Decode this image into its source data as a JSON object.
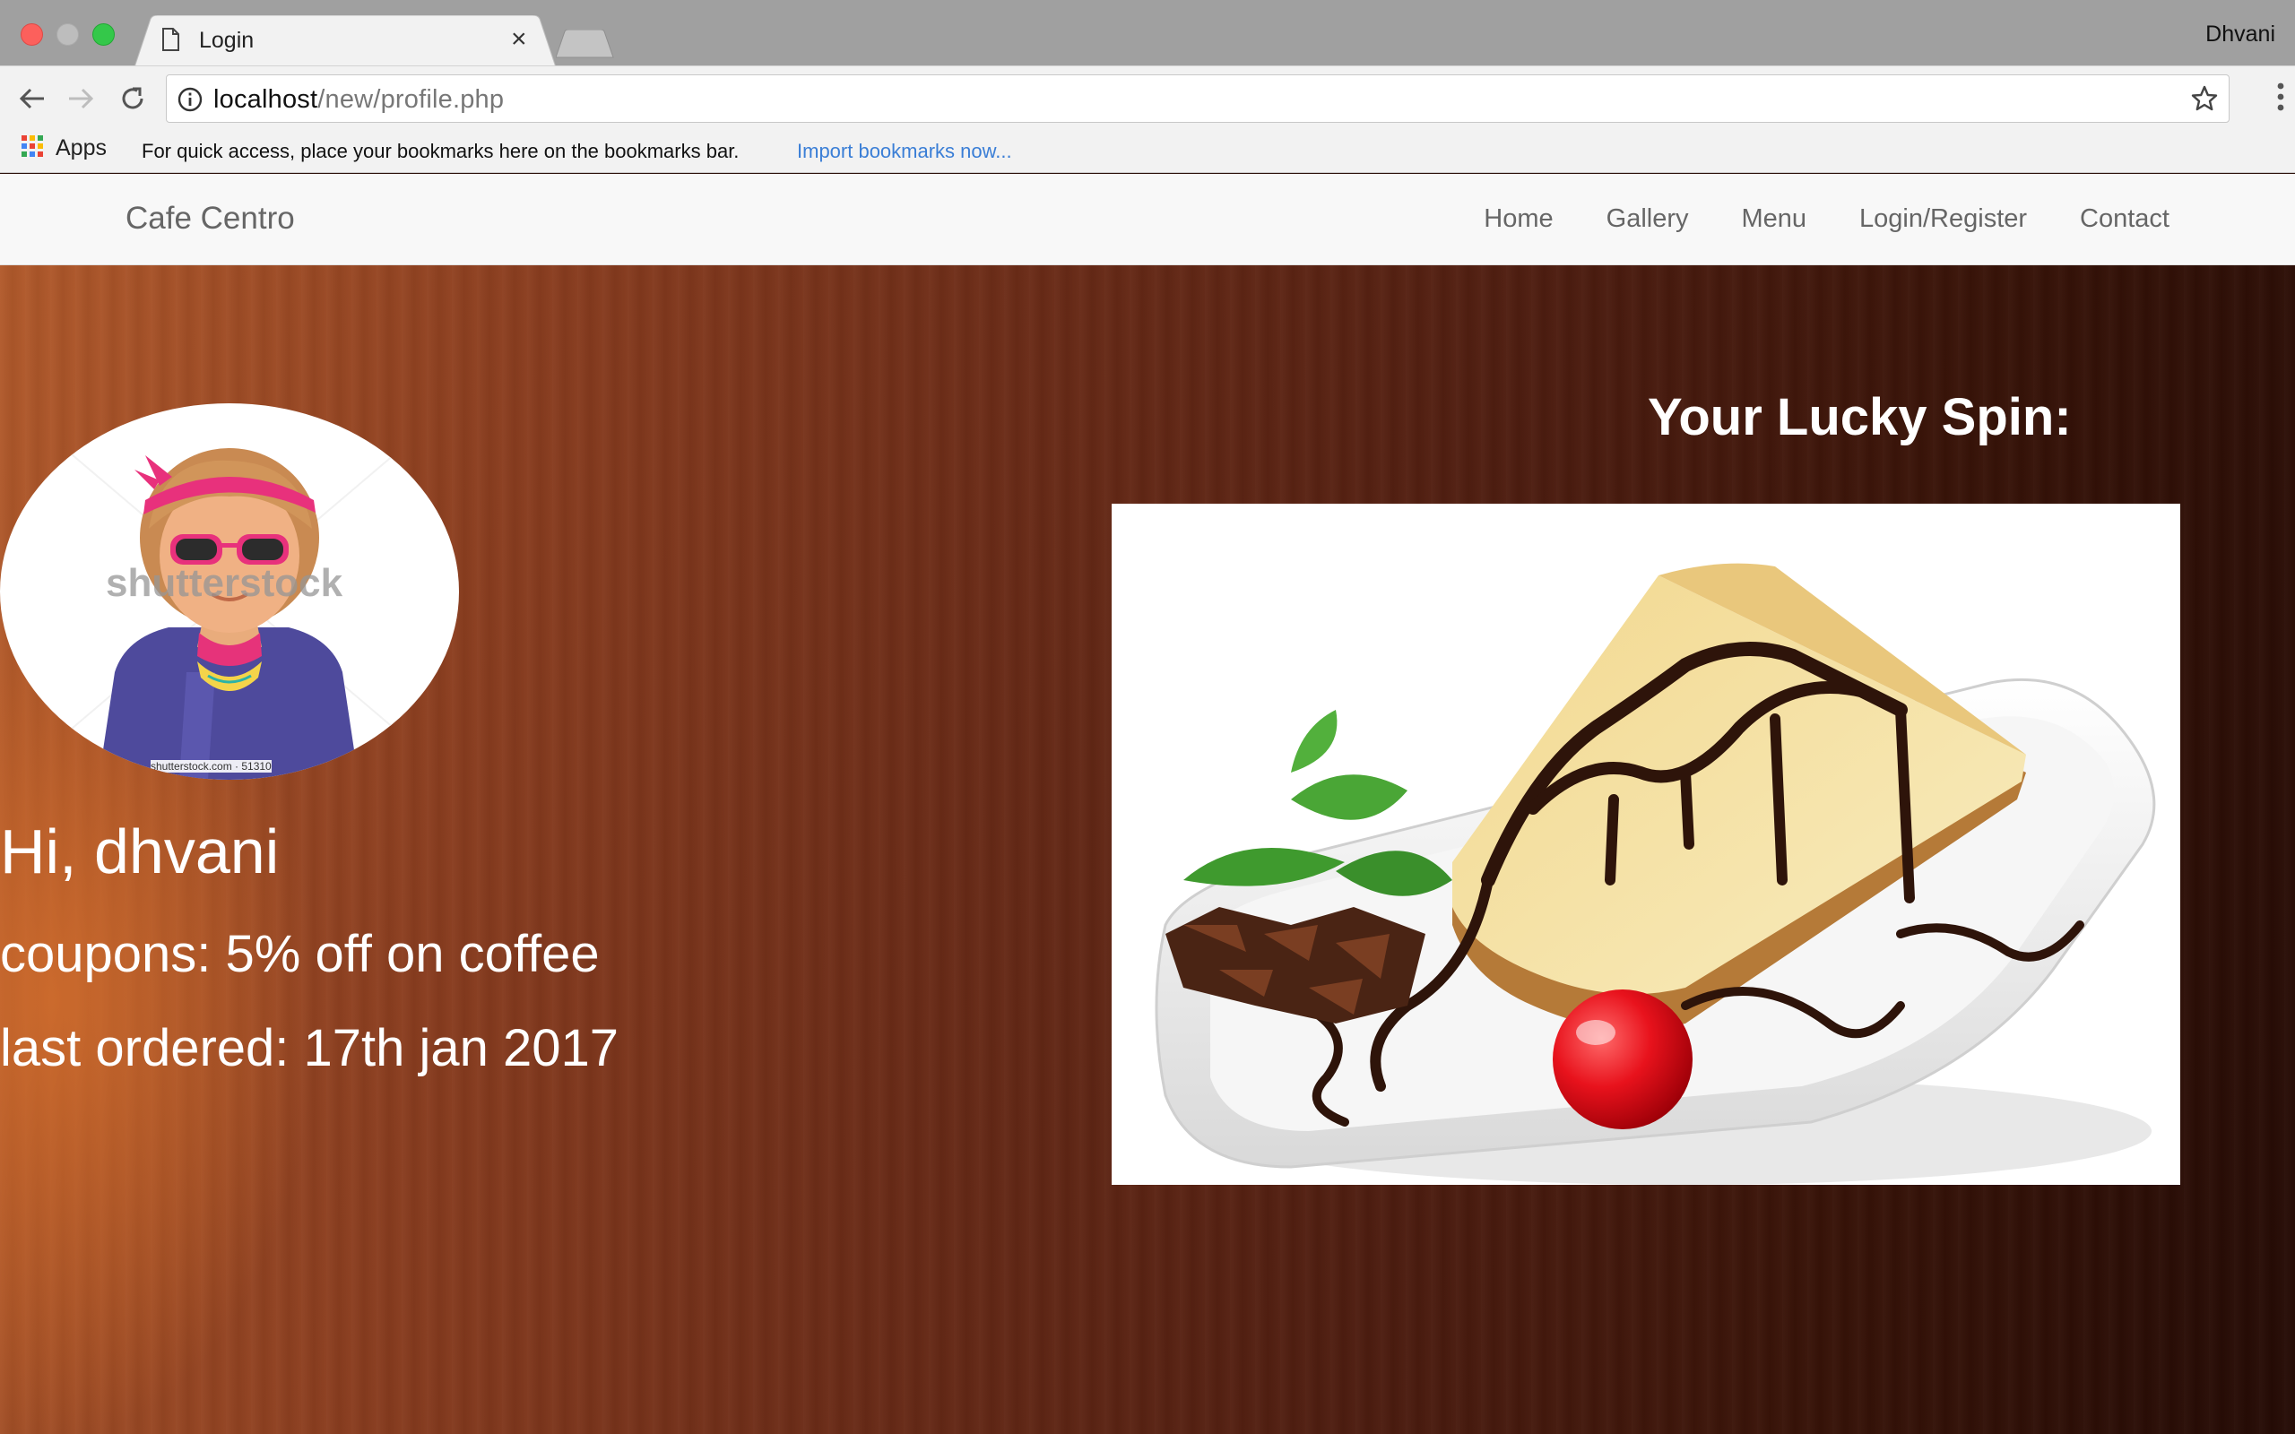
{
  "browser": {
    "tab_title": "Login",
    "profile_name": "Dhvani",
    "url_host": "localhost",
    "url_path": "/new/profile.php",
    "bookmarks_bar": {
      "apps_label": "Apps",
      "hint": "For quick access, place your bookmarks here on the bookmarks bar.",
      "import_link": "Import bookmarks now..."
    }
  },
  "site": {
    "brand": "Cafe Centro",
    "nav": [
      "Home",
      "Gallery",
      "Menu",
      "Login/Register",
      "Contact"
    ]
  },
  "profile": {
    "greeting": "Hi, dhvani",
    "coupons": "coupons: 5% off on coffee",
    "last_ordered": "last ordered: 17th jan 2017",
    "avatar_watermark": "shutterstock",
    "avatar_caption": "shutterstock.com · 51310"
  },
  "lucky_spin": {
    "title": "Your Lucky Spin:",
    "image": "cheesecake-with-chocolate-sauce"
  },
  "colors": {
    "link_blue": "#3a7ed6",
    "hero_light": "#b25a2b",
    "hero_dark": "#250b05"
  }
}
